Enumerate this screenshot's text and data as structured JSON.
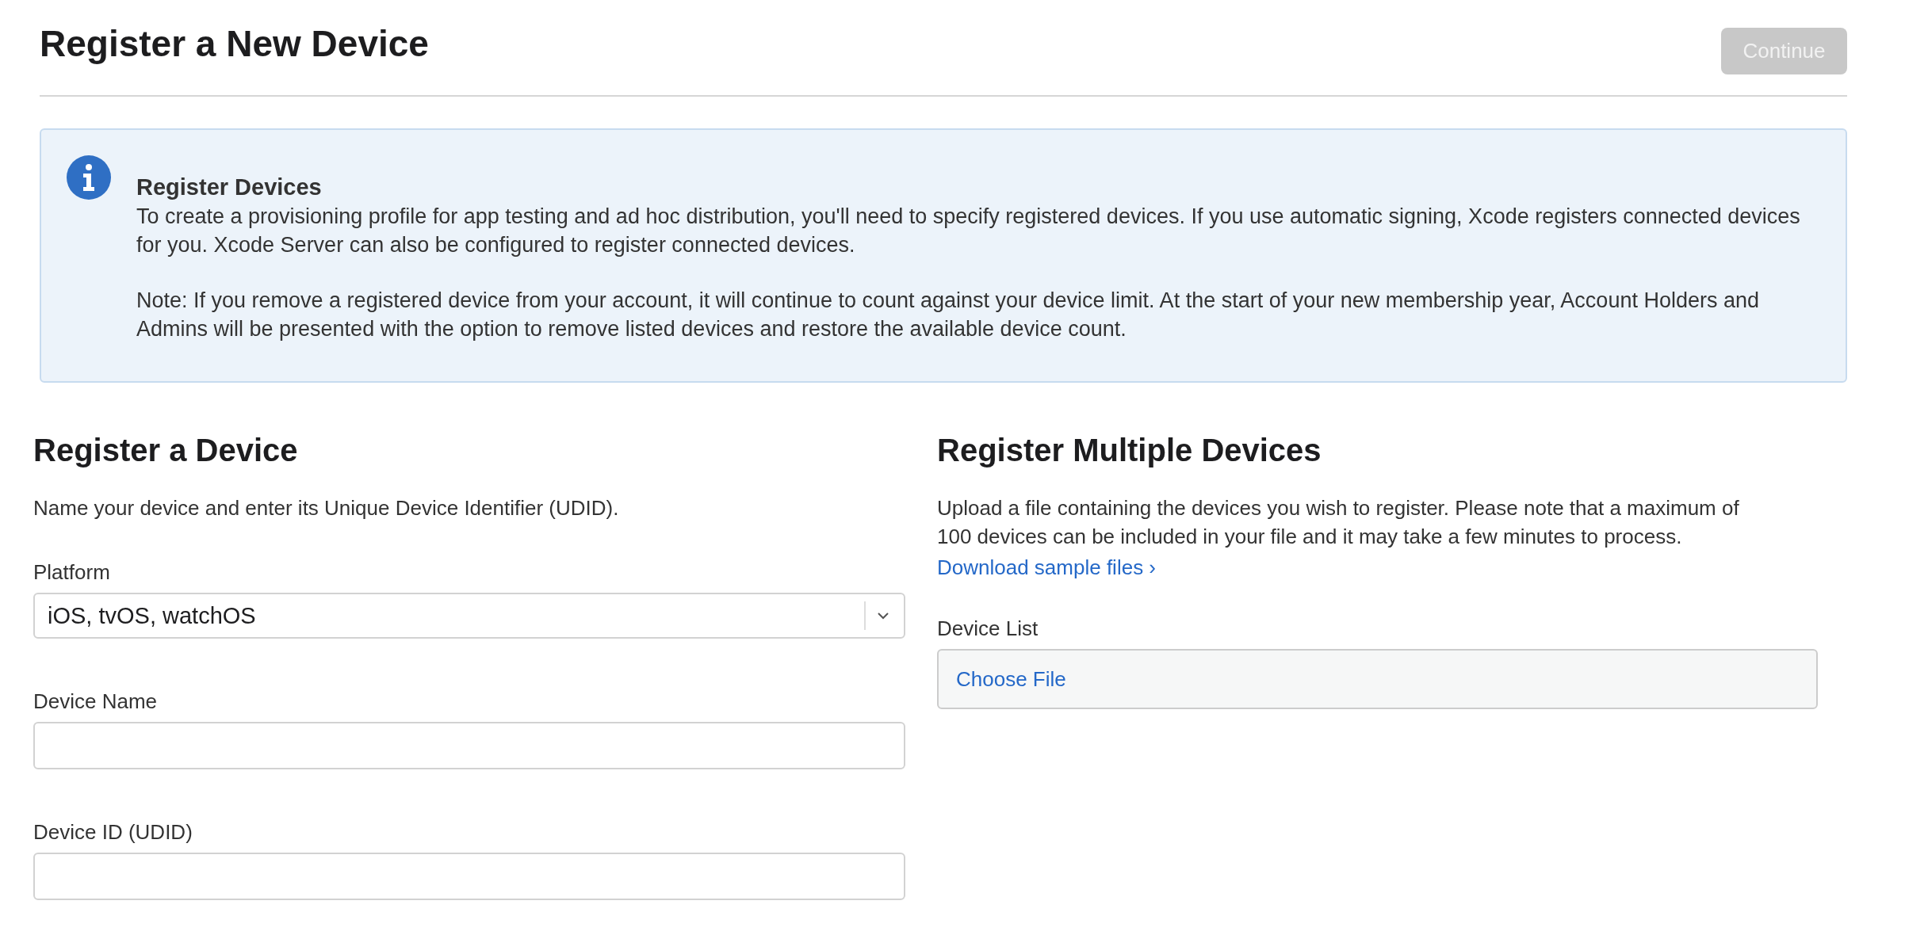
{
  "header": {
    "title": "Register a New Device",
    "continue_button": {
      "label": "Continue",
      "disabled": true
    }
  },
  "info": {
    "title": "Register Devices",
    "paragraphs": [
      "To create a provisioning profile for app testing and ad hoc distribution, you'll need to specify registered devices. If you use automatic signing, Xcode registers connected devices for you. Xcode Server can also be configured to register connected devices.",
      "Note: If you remove a registered device from your account, it will continue to count against your device limit. At the start of your new membership year, Account Holders and Admins will be presented with the option to remove listed devices and restore the available device count."
    ]
  },
  "single": {
    "heading": "Register a Device",
    "description": "Name your device and enter its Unique Device Identifier (UDID).",
    "fields": [
      {
        "kind": "select",
        "label": "Platform",
        "value": "iOS, tvOS, watchOS"
      },
      {
        "kind": "text",
        "label": "Device Name"
      },
      {
        "kind": "text",
        "label": "Device ID (UDID)"
      }
    ]
  },
  "multiple": {
    "heading": "Register Multiple Devices",
    "description": "Upload a file containing the devices you wish to register. Please note that a maximum of 100 devices can be included in your file and it may take a few minutes to process.",
    "link": "Download sample files ›",
    "file_label": "Device List",
    "file_button": "Choose File"
  }
}
